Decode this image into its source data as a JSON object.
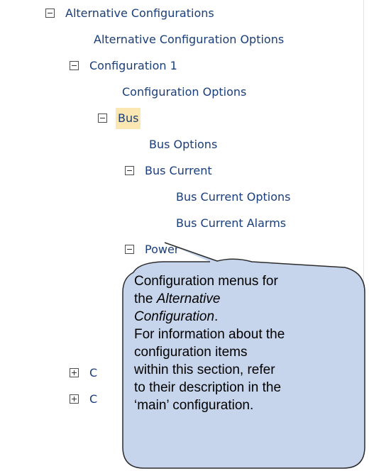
{
  "tree": {
    "items": [
      {
        "label": "Alternative Configurations",
        "toggle": "minus"
      },
      {
        "label": "Alternative Configuration Options",
        "toggle": null
      },
      {
        "label": "Configuration 1",
        "toggle": "minus"
      },
      {
        "label": "Configuration Options",
        "toggle": null
      },
      {
        "label": "Bus",
        "toggle": "minus",
        "selected": true
      },
      {
        "label": "Bus Options",
        "toggle": null
      },
      {
        "label": "Bus Current",
        "toggle": "minus"
      },
      {
        "label": "Bus Current Options",
        "toggle": null
      },
      {
        "label": "Bus Current Alarms",
        "toggle": null
      },
      {
        "label": "Power",
        "toggle": "minus"
      },
      {
        "label": "C",
        "toggle": "plus"
      },
      {
        "label": "C",
        "toggle": "plus"
      }
    ]
  },
  "callout": {
    "line1": "Configuration menus for",
    "line2": "the ",
    "line2_italic": "Alternative",
    "line3_italic": "Configuration",
    "line3_end": ".",
    "line4": "For information about the",
    "line5": "configuration items",
    "line6": "within this section, refer",
    "line7": "to their description in the",
    "line8": "‘main’ configuration."
  },
  "colors": {
    "tree_text": "#1a3e7a",
    "selected_highlight": "#fbe7b1",
    "callout_fill": "#c6d5ec",
    "callout_border": "#2b2b2b"
  }
}
